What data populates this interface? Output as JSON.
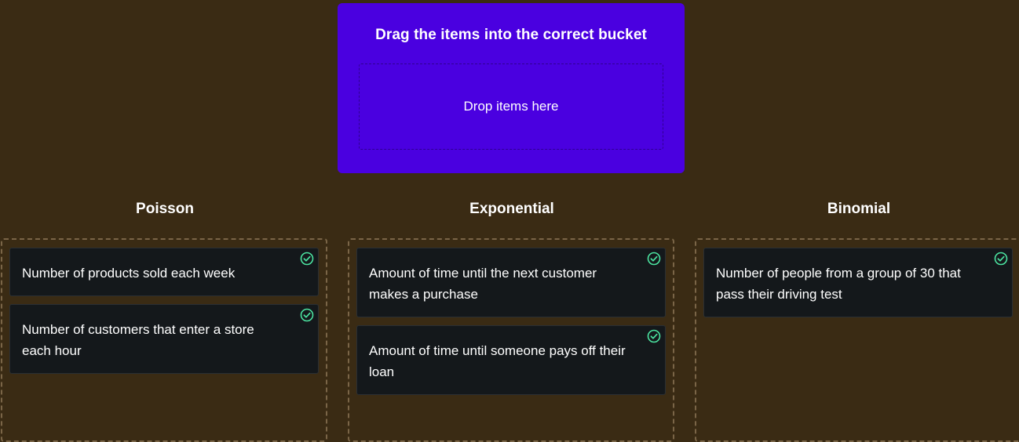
{
  "prompt": {
    "title": "Drag the items into the correct bucket",
    "drop_placeholder": "Drop items here"
  },
  "buckets": [
    {
      "heading": "Poisson",
      "items": [
        {
          "text": "Number of products sold each week",
          "status": "correct"
        },
        {
          "text": "Number of customers that enter a store each hour",
          "status": "correct"
        }
      ]
    },
    {
      "heading": "Exponential",
      "items": [
        {
          "text": "Amount of time until the next customer makes a purchase",
          "status": "correct"
        },
        {
          "text": "Amount of time until someone pays off their loan",
          "status": "correct"
        }
      ]
    },
    {
      "heading": "Binomial",
      "items": [
        {
          "text": "Number of people from a group of 30 that pass their driving test",
          "status": "correct"
        }
      ]
    }
  ],
  "colors": {
    "background": "#3a2b14",
    "prompt_panel": "#4a00e0",
    "card": "#14181b",
    "check": "#4be3a0"
  },
  "icons": {
    "correct": "check-circle-icon"
  }
}
